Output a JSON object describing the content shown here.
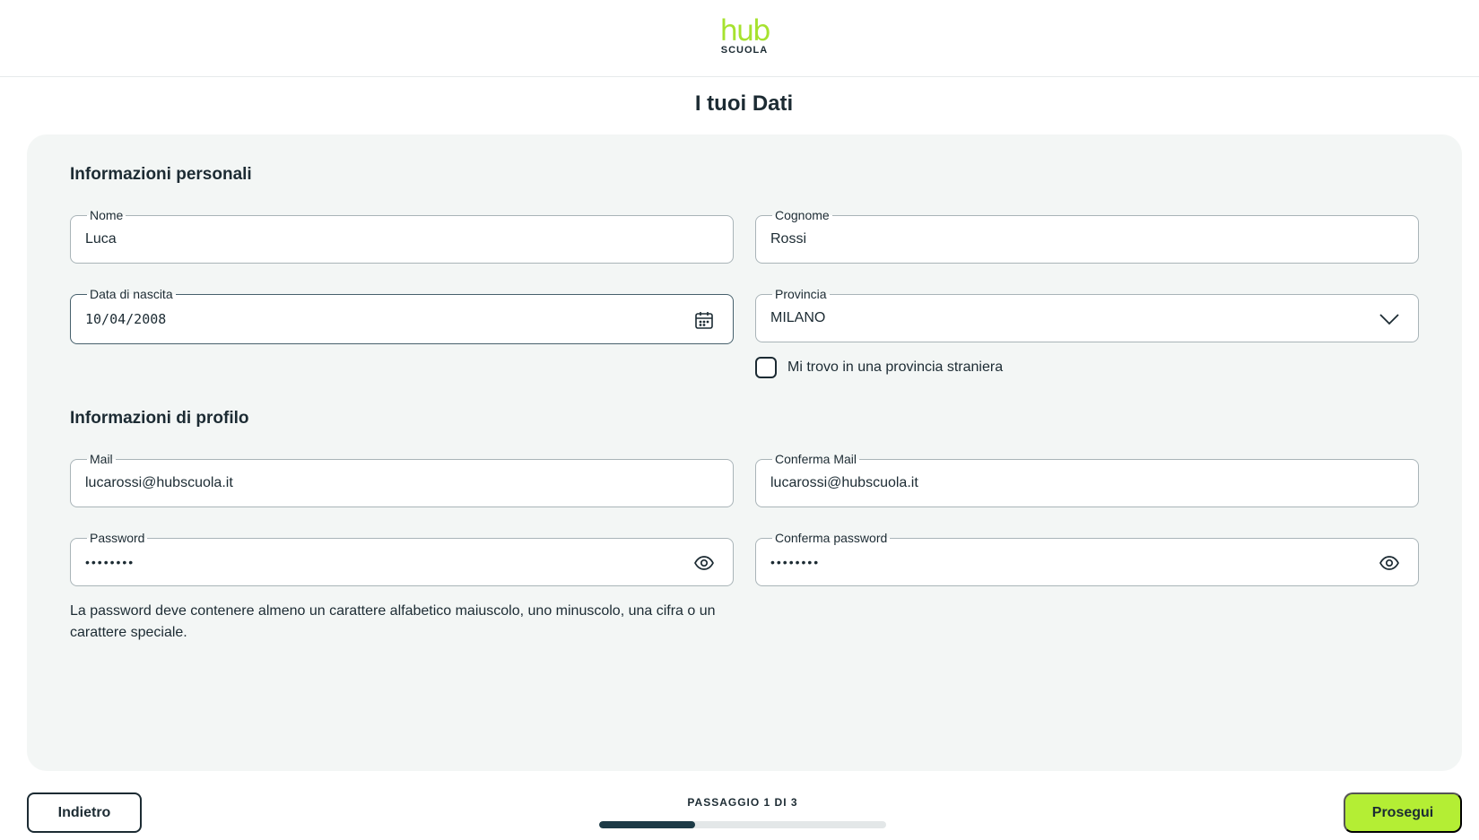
{
  "header": {
    "logo_main": "hub",
    "logo_sub": "SCUOLA"
  },
  "page_title": "I tuoi Dati",
  "personal": {
    "section_title": "Informazioni personali",
    "nome": {
      "label": "Nome",
      "value": "Luca"
    },
    "cognome": {
      "label": "Cognome",
      "value": "Rossi"
    },
    "data_nascita": {
      "label": "Data di nascita",
      "value": "10/04/2008",
      "icon": "calendar-icon"
    },
    "provincia": {
      "label": "Provincia",
      "value": "MILANO",
      "icon": "chevron-down-icon"
    },
    "foreign_province_checkbox": {
      "label": "Mi trovo in una provincia straniera",
      "checked": false
    }
  },
  "profile": {
    "section_title": "Informazioni di profilo",
    "mail": {
      "label": "Mail",
      "value": "lucarossi@hubscuola.it"
    },
    "conferma_mail": {
      "label": "Conferma Mail",
      "value": "lucarossi@hubscuola.it"
    },
    "password": {
      "label": "Password",
      "value": "••••••••",
      "icon": "eye-icon"
    },
    "conferma_password": {
      "label": "Conferma password",
      "value": "••••••••",
      "icon": "eye-icon"
    },
    "hint": "La password deve contenere almeno un carattere alfabetico maiuscolo, uno minuscolo, una cifra o un carattere speciale."
  },
  "footer": {
    "back_label": "Indietro",
    "next_label": "Prosegui",
    "step_text": "PASSAGGIO 1 DI 3",
    "progress_fraction": 0.333
  },
  "colors": {
    "accent": "#b4ee34",
    "logo_green": "#a6e22e",
    "text_dark": "#1c2b33",
    "card_bg": "#f3f6f5",
    "progress_fill": "#1c3a46"
  }
}
